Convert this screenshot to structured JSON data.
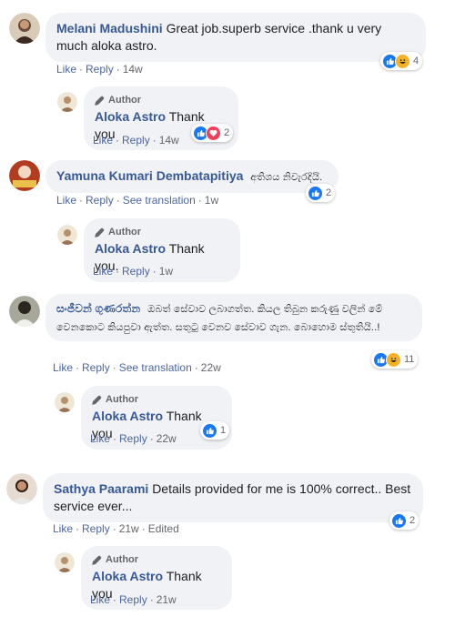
{
  "comments": [
    {
      "author": "Melani Madushini",
      "text": "Great job.superb service .thank u very much aloka astro.",
      "actions": {
        "like": "Like",
        "reply": "Reply",
        "time": "14w"
      },
      "reaction_count": "4",
      "reaction_icons": [
        "like-icon",
        "haha-icon"
      ],
      "reply": {
        "badge": "Author",
        "author": "Aloka Astro",
        "text": "Thank you",
        "actions": {
          "like": "Like",
          "reply": "Reply",
          "time": "14w"
        },
        "reaction_count": "2",
        "reaction_icons": [
          "like-icon",
          "love-icon"
        ]
      }
    },
    {
      "author": "Yamuna Kumari Dembatapitiya",
      "text": "අතිශය නිවැරදියි.",
      "actions": {
        "like": "Like",
        "reply": "Reply",
        "translate": "See translation",
        "time": "1w"
      },
      "reaction_count": "2",
      "reaction_icons": [
        "like-icon"
      ],
      "reply": {
        "badge": "Author",
        "author": "Aloka Astro",
        "text": "Thank you.",
        "actions": {
          "like": "Like",
          "reply": "Reply",
          "time": "1w"
        }
      }
    },
    {
      "author": "සංජීවන් ගුණරත්න",
      "text": "ඔබත් සේවාව ලබාගත්ත. කියල තිබුන කරුණු වලින් මේ වෙනකොට කියපුවා ඇත්ත. සතුටු වෙනව සේවාව ගැන. බොහොම ස්තුතියි..!",
      "actions": {
        "like": "Like",
        "reply": "Reply",
        "translate": "See translation",
        "time": "22w"
      },
      "reaction_count": "11",
      "reaction_icons": [
        "like-icon",
        "haha-icon"
      ],
      "reply": {
        "badge": "Author",
        "author": "Aloka Astro",
        "text": "Thank you",
        "actions": {
          "like": "Like",
          "reply": "Reply",
          "time": "22w"
        },
        "reaction_count": "1",
        "reaction_icons": [
          "like-icon"
        ]
      }
    },
    {
      "author": "Sathya Paarami",
      "text": "Details provided for me is 100% correct.. Best service ever...",
      "actions": {
        "like": "Like",
        "reply": "Reply",
        "time": "21w",
        "edited": "Edited"
      },
      "reaction_count": "2",
      "reaction_icons": [
        "like-icon"
      ],
      "reply": {
        "badge": "Author",
        "author": "Aloka Astro",
        "text": "Thank you",
        "actions": {
          "like": "Like",
          "reply": "Reply",
          "time": "21w"
        }
      }
    }
  ],
  "colors": {
    "link_blue": "#385898",
    "bubble_bg": "#f0f2f5",
    "meta_gray": "#65676b",
    "like_blue": "#1877f2",
    "haha_yellow": "#f7b125",
    "love_red": "#f33e58"
  }
}
